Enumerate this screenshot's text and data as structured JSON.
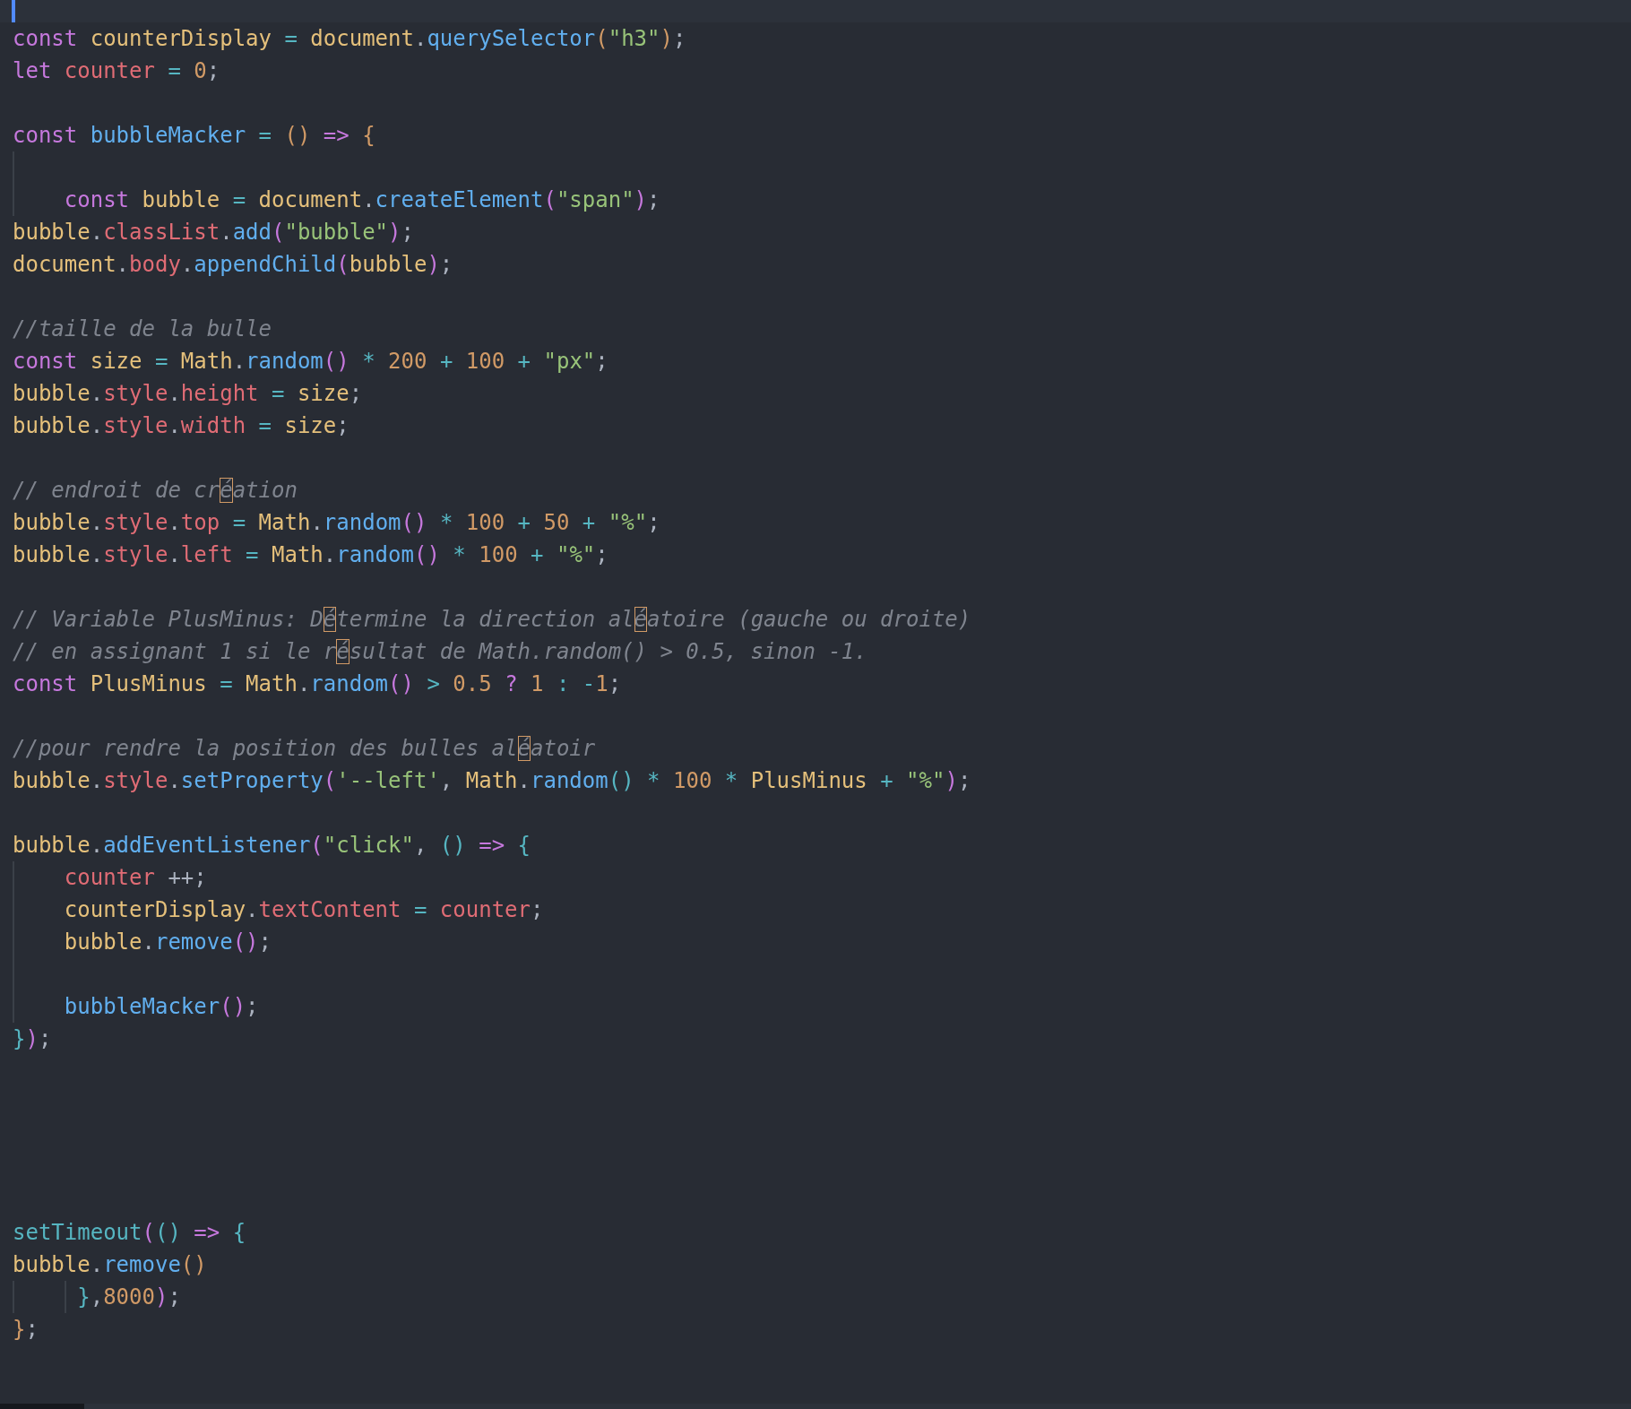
{
  "editor": {
    "lines": [
      {
        "kind": "code",
        "tokens": [
          {
            "kind": "kw",
            "text": "const "
          },
          {
            "kind": "id",
            "text": "counterDisplay"
          },
          {
            "kind": "op",
            "text": " = "
          },
          {
            "kind": "id",
            "text": "document"
          },
          {
            "kind": "pun",
            "text": "."
          },
          {
            "kind": "fn",
            "text": "querySelector"
          },
          {
            "kind": "br1",
            "text": "("
          },
          {
            "kind": "str",
            "text": "\"h3\""
          },
          {
            "kind": "br1",
            "text": ")"
          },
          {
            "kind": "pun",
            "text": ";"
          }
        ]
      },
      {
        "kind": "code",
        "tokens": [
          {
            "kind": "kw",
            "text": "let "
          },
          {
            "kind": "var",
            "text": "counter"
          },
          {
            "kind": "op",
            "text": " = "
          },
          {
            "kind": "num",
            "text": "0"
          },
          {
            "kind": "pun",
            "text": ";"
          }
        ]
      },
      {
        "kind": "blank"
      },
      {
        "kind": "code",
        "tokens": [
          {
            "kind": "kw",
            "text": "const "
          },
          {
            "kind": "fn",
            "text": "bubbleMacker"
          },
          {
            "kind": "op",
            "text": " = "
          },
          {
            "kind": "br1",
            "text": "()"
          },
          {
            "kind": "kw",
            "text": " => "
          },
          {
            "kind": "br1",
            "text": "{"
          }
        ]
      },
      {
        "kind": "blank",
        "guide": true
      },
      {
        "kind": "code",
        "indented": true,
        "guide": true,
        "tokens": [
          {
            "kind": "kw",
            "text": "const "
          },
          {
            "kind": "id",
            "text": "bubble"
          },
          {
            "kind": "op",
            "text": " = "
          },
          {
            "kind": "id",
            "text": "document"
          },
          {
            "kind": "pun",
            "text": "."
          },
          {
            "kind": "fn",
            "text": "createElement"
          },
          {
            "kind": "br2",
            "text": "("
          },
          {
            "kind": "str",
            "text": "\"span\""
          },
          {
            "kind": "br2",
            "text": ")"
          },
          {
            "kind": "pun",
            "text": ";"
          }
        ]
      },
      {
        "kind": "code",
        "tokens": [
          {
            "kind": "id",
            "text": "bubble"
          },
          {
            "kind": "pun",
            "text": "."
          },
          {
            "kind": "var",
            "text": "classList"
          },
          {
            "kind": "pun",
            "text": "."
          },
          {
            "kind": "fn",
            "text": "add"
          },
          {
            "kind": "br2",
            "text": "("
          },
          {
            "kind": "str",
            "text": "\"bubble\""
          },
          {
            "kind": "br2",
            "text": ")"
          },
          {
            "kind": "pun",
            "text": ";"
          }
        ]
      },
      {
        "kind": "code",
        "tokens": [
          {
            "kind": "id",
            "text": "document"
          },
          {
            "kind": "pun",
            "text": "."
          },
          {
            "kind": "var",
            "text": "body"
          },
          {
            "kind": "pun",
            "text": "."
          },
          {
            "kind": "fn",
            "text": "appendChild"
          },
          {
            "kind": "br2",
            "text": "("
          },
          {
            "kind": "id",
            "text": "bubble"
          },
          {
            "kind": "br2",
            "text": ")"
          },
          {
            "kind": "pun",
            "text": ";"
          }
        ]
      },
      {
        "kind": "blank"
      },
      {
        "kind": "code",
        "tokens": [
          {
            "kind": "com",
            "text": "//taille de la bulle"
          }
        ]
      },
      {
        "kind": "code",
        "tokens": [
          {
            "kind": "kw",
            "text": "const "
          },
          {
            "kind": "id",
            "text": "size"
          },
          {
            "kind": "op",
            "text": " = "
          },
          {
            "kind": "id",
            "text": "Math"
          },
          {
            "kind": "pun",
            "text": "."
          },
          {
            "kind": "fn",
            "text": "random"
          },
          {
            "kind": "br2",
            "text": "()"
          },
          {
            "kind": "op",
            "text": " * "
          },
          {
            "kind": "num",
            "text": "200"
          },
          {
            "kind": "op",
            "text": " + "
          },
          {
            "kind": "num",
            "text": "100"
          },
          {
            "kind": "op",
            "text": " + "
          },
          {
            "kind": "str",
            "text": "\"px\""
          },
          {
            "kind": "pun",
            "text": ";"
          }
        ]
      },
      {
        "kind": "code",
        "tokens": [
          {
            "kind": "id",
            "text": "bubble"
          },
          {
            "kind": "pun",
            "text": "."
          },
          {
            "kind": "var",
            "text": "style"
          },
          {
            "kind": "pun",
            "text": "."
          },
          {
            "kind": "var",
            "text": "height"
          },
          {
            "kind": "op",
            "text": " = "
          },
          {
            "kind": "id",
            "text": "size"
          },
          {
            "kind": "pun",
            "text": ";"
          }
        ]
      },
      {
        "kind": "code",
        "tokens": [
          {
            "kind": "id",
            "text": "bubble"
          },
          {
            "kind": "pun",
            "text": "."
          },
          {
            "kind": "var",
            "text": "style"
          },
          {
            "kind": "pun",
            "text": "."
          },
          {
            "kind": "var",
            "text": "width"
          },
          {
            "kind": "op",
            "text": " = "
          },
          {
            "kind": "id",
            "text": "size"
          },
          {
            "kind": "pun",
            "text": ";"
          }
        ]
      },
      {
        "kind": "blank"
      },
      {
        "kind": "code",
        "tokens": [
          {
            "kind": "com",
            "text": "// endroit de cr"
          },
          {
            "kind": "uni",
            "text": "é"
          },
          {
            "kind": "com",
            "text": "ation"
          }
        ]
      },
      {
        "kind": "code",
        "tokens": [
          {
            "kind": "id",
            "text": "bubble"
          },
          {
            "kind": "pun",
            "text": "."
          },
          {
            "kind": "var",
            "text": "style"
          },
          {
            "kind": "pun",
            "text": "."
          },
          {
            "kind": "var",
            "text": "top"
          },
          {
            "kind": "op",
            "text": " = "
          },
          {
            "kind": "id",
            "text": "Math"
          },
          {
            "kind": "pun",
            "text": "."
          },
          {
            "kind": "fn",
            "text": "random"
          },
          {
            "kind": "br2",
            "text": "()"
          },
          {
            "kind": "op",
            "text": " * "
          },
          {
            "kind": "num",
            "text": "100"
          },
          {
            "kind": "op",
            "text": " + "
          },
          {
            "kind": "num",
            "text": "50"
          },
          {
            "kind": "op",
            "text": " + "
          },
          {
            "kind": "str",
            "text": "\"%\""
          },
          {
            "kind": "pun",
            "text": ";"
          }
        ]
      },
      {
        "kind": "code",
        "tokens": [
          {
            "kind": "id",
            "text": "bubble"
          },
          {
            "kind": "pun",
            "text": "."
          },
          {
            "kind": "var",
            "text": "style"
          },
          {
            "kind": "pun",
            "text": "."
          },
          {
            "kind": "var",
            "text": "left"
          },
          {
            "kind": "op",
            "text": " = "
          },
          {
            "kind": "id",
            "text": "Math"
          },
          {
            "kind": "pun",
            "text": "."
          },
          {
            "kind": "fn",
            "text": "random"
          },
          {
            "kind": "br2",
            "text": "()"
          },
          {
            "kind": "op",
            "text": " * "
          },
          {
            "kind": "num",
            "text": "100"
          },
          {
            "kind": "op",
            "text": " + "
          },
          {
            "kind": "str",
            "text": "\"%\""
          },
          {
            "kind": "pun",
            "text": ";"
          }
        ]
      },
      {
        "kind": "blank"
      },
      {
        "kind": "code",
        "tokens": [
          {
            "kind": "com",
            "text": "// Variable PlusMinus: D"
          },
          {
            "kind": "uni",
            "text": "é"
          },
          {
            "kind": "com",
            "text": "termine la direction al"
          },
          {
            "kind": "uni",
            "text": "é"
          },
          {
            "kind": "com",
            "text": "atoire (gauche ou droite)"
          }
        ]
      },
      {
        "kind": "code",
        "tokens": [
          {
            "kind": "com",
            "text": "// en assignant 1 si le r"
          },
          {
            "kind": "uni",
            "text": "é"
          },
          {
            "kind": "com",
            "text": "sultat de Math.random() > 0.5, sinon -1."
          }
        ]
      },
      {
        "kind": "code",
        "tokens": [
          {
            "kind": "kw",
            "text": "const "
          },
          {
            "kind": "id",
            "text": "PlusMinus"
          },
          {
            "kind": "op",
            "text": " = "
          },
          {
            "kind": "id",
            "text": "Math"
          },
          {
            "kind": "pun",
            "text": "."
          },
          {
            "kind": "fn",
            "text": "random"
          },
          {
            "kind": "br2",
            "text": "()"
          },
          {
            "kind": "op",
            "text": " > "
          },
          {
            "kind": "num",
            "text": "0.5"
          },
          {
            "kind": "kw",
            "text": " ? "
          },
          {
            "kind": "num",
            "text": "1"
          },
          {
            "kind": "op",
            "text": " : -"
          },
          {
            "kind": "num",
            "text": "1"
          },
          {
            "kind": "pun",
            "text": ";"
          }
        ]
      },
      {
        "kind": "blank"
      },
      {
        "kind": "code",
        "tokens": [
          {
            "kind": "com",
            "text": "//pour rendre la position des bulles al"
          },
          {
            "kind": "uni",
            "text": "é"
          },
          {
            "kind": "com",
            "text": "atoir"
          }
        ]
      },
      {
        "kind": "code",
        "tokens": [
          {
            "kind": "id",
            "text": "bubble"
          },
          {
            "kind": "pun",
            "text": "."
          },
          {
            "kind": "var",
            "text": "style"
          },
          {
            "kind": "pun",
            "text": "."
          },
          {
            "kind": "fn",
            "text": "setProperty"
          },
          {
            "kind": "br2",
            "text": "("
          },
          {
            "kind": "str",
            "text": "'--left'"
          },
          {
            "kind": "pun",
            "text": ", "
          },
          {
            "kind": "id",
            "text": "Math"
          },
          {
            "kind": "pun",
            "text": "."
          },
          {
            "kind": "fn",
            "text": "random"
          },
          {
            "kind": "br3",
            "text": "()"
          },
          {
            "kind": "op",
            "text": " * "
          },
          {
            "kind": "num",
            "text": "100"
          },
          {
            "kind": "op",
            "text": " * "
          },
          {
            "kind": "id",
            "text": "PlusMinus"
          },
          {
            "kind": "op",
            "text": " + "
          },
          {
            "kind": "str",
            "text": "\"%\""
          },
          {
            "kind": "br2",
            "text": ")"
          },
          {
            "kind": "pun",
            "text": ";"
          }
        ]
      },
      {
        "kind": "blank"
      },
      {
        "kind": "code",
        "tokens": [
          {
            "kind": "id",
            "text": "bubble"
          },
          {
            "kind": "pun",
            "text": "."
          },
          {
            "kind": "fn",
            "text": "addEventListener"
          },
          {
            "kind": "br2",
            "text": "("
          },
          {
            "kind": "str",
            "text": "\"click\""
          },
          {
            "kind": "pun",
            "text": ", "
          },
          {
            "kind": "br3",
            "text": "()"
          },
          {
            "kind": "kw",
            "text": " => "
          },
          {
            "kind": "br3",
            "text": "{"
          }
        ]
      },
      {
        "kind": "code",
        "indented": true,
        "guide": true,
        "tokens": [
          {
            "kind": "var",
            "text": "counter"
          },
          {
            "kind": "pun",
            "text": " ++;"
          }
        ]
      },
      {
        "kind": "code",
        "indented": true,
        "guide": true,
        "tokens": [
          {
            "kind": "id",
            "text": "counterDisplay"
          },
          {
            "kind": "pun",
            "text": "."
          },
          {
            "kind": "var",
            "text": "textContent"
          },
          {
            "kind": "op",
            "text": " = "
          },
          {
            "kind": "var",
            "text": "counter"
          },
          {
            "kind": "pun",
            "text": ";"
          }
        ]
      },
      {
        "kind": "code",
        "indented": true,
        "guide": true,
        "tokens": [
          {
            "kind": "id",
            "text": "bubble"
          },
          {
            "kind": "pun",
            "text": "."
          },
          {
            "kind": "fn",
            "text": "remove"
          },
          {
            "kind": "br2",
            "text": "()"
          },
          {
            "kind": "pun",
            "text": ";"
          }
        ]
      },
      {
        "kind": "blank",
        "guide": true
      },
      {
        "kind": "code",
        "indented": true,
        "guide": true,
        "tokens": [
          {
            "kind": "fn",
            "text": "bubbleMacker"
          },
          {
            "kind": "br2",
            "text": "()"
          },
          {
            "kind": "pun",
            "text": ";"
          }
        ]
      },
      {
        "kind": "code",
        "tokens": [
          {
            "kind": "br3",
            "text": "}"
          },
          {
            "kind": "br2",
            "text": ")"
          },
          {
            "kind": "pun",
            "text": ";"
          }
        ]
      },
      {
        "kind": "blank"
      },
      {
        "kind": "blank"
      },
      {
        "kind": "blank"
      },
      {
        "kind": "blank"
      },
      {
        "kind": "blank"
      },
      {
        "kind": "code",
        "tokens": [
          {
            "kind": "builtin",
            "text": "setTimeout"
          },
          {
            "kind": "br2",
            "text": "("
          },
          {
            "kind": "br3",
            "text": "()"
          },
          {
            "kind": "kw",
            "text": " => "
          },
          {
            "kind": "br3",
            "text": "{"
          }
        ]
      },
      {
        "kind": "code",
        "tokens": [
          {
            "kind": "id",
            "text": "bubble"
          },
          {
            "kind": "pun",
            "text": "."
          },
          {
            "kind": "fn",
            "text": "remove"
          },
          {
            "kind": "br1",
            "text": "()"
          }
        ]
      },
      {
        "kind": "code",
        "indented": true,
        "deep": true,
        "guide": true,
        "tokens": [
          {
            "kind": "br3",
            "text": "}"
          },
          {
            "kind": "pun",
            "text": ","
          },
          {
            "kind": "num",
            "text": "8000"
          },
          {
            "kind": "br2",
            "text": ")"
          },
          {
            "kind": "pun",
            "text": ";"
          }
        ]
      },
      {
        "kind": "code",
        "tokens": [
          {
            "kind": "br1",
            "text": "}"
          },
          {
            "kind": "pun",
            "text": ";"
          }
        ]
      }
    ]
  }
}
